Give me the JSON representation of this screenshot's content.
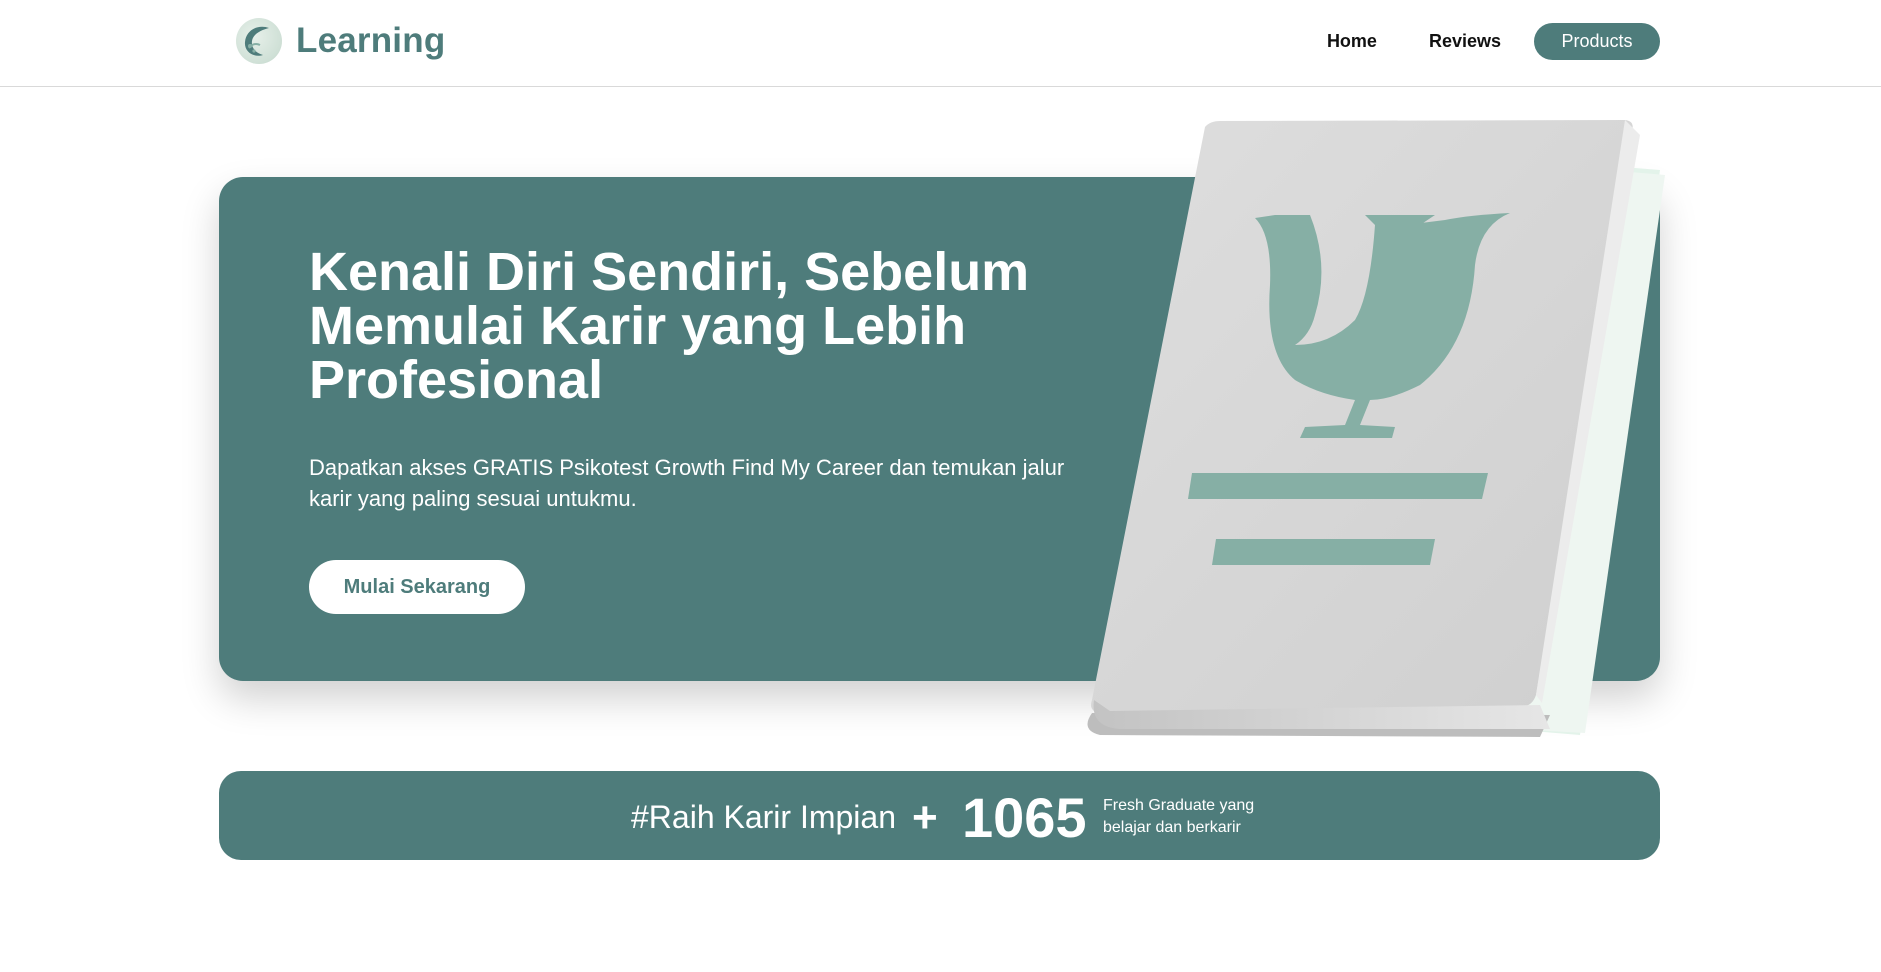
{
  "header": {
    "brand": "Learning",
    "nav": {
      "home": "Home",
      "reviews": "Reviews",
      "products": "Products"
    }
  },
  "hero": {
    "title": "Kenali Diri Sendiri, Sebelum Memulai Karir yang Lebih Profesional",
    "description": "Dapatkan akses GRATIS Psikotest Growth Find My Career dan temukan jalur karir yang paling sesuai untukmu.",
    "cta_label": "Mulai Sekarang",
    "illustration": "psychology-book-icon"
  },
  "stats": {
    "tagline": "#Raih Karir Impian",
    "plus": "+",
    "count": "1065",
    "description": "Fresh Graduate yang belajar dan berkarir"
  },
  "colors": {
    "primary": "#4e7c7b",
    "accent": "#86afa5",
    "book_cover": "#d7d7d7",
    "white": "#ffffff"
  }
}
